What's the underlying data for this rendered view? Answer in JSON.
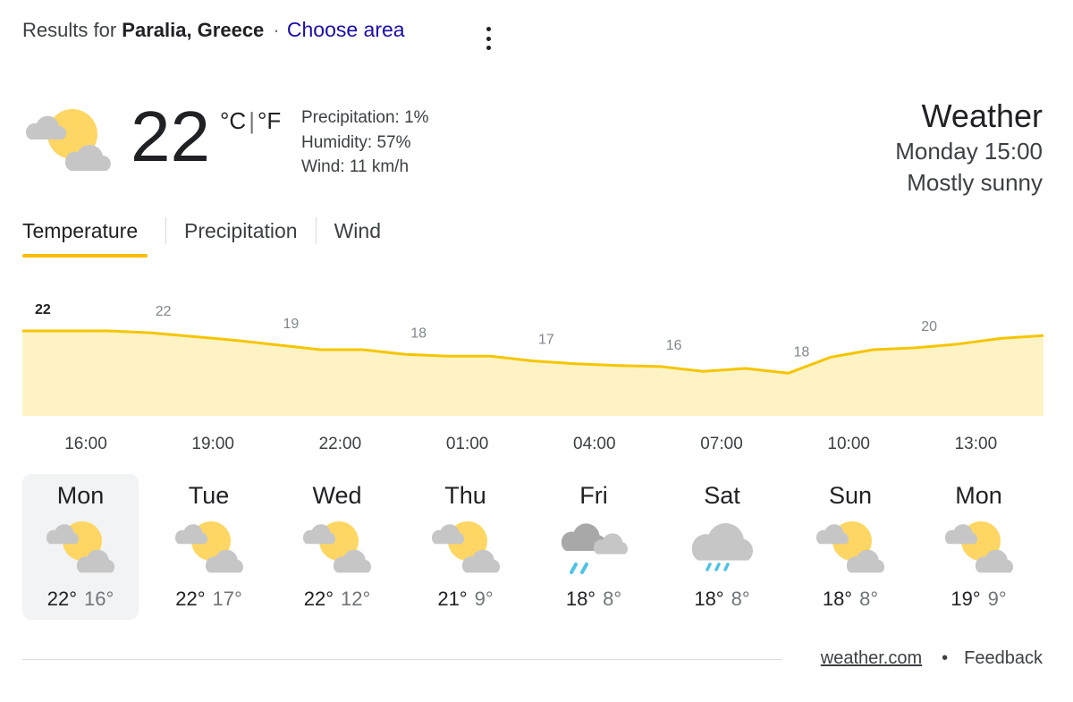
{
  "header": {
    "results_prefix": "Results for",
    "location": "Paralia, Greece",
    "separator": "·",
    "choose_area": "Choose area"
  },
  "current": {
    "icon": "partly-sunny-icon",
    "temperature": "22",
    "unit_c": "°C",
    "unit_sep": "|",
    "unit_f": "°F",
    "precipitation": "Precipitation: 1%",
    "humidity": "Humidity: 57%",
    "wind": "Wind: 11 km/h"
  },
  "summary": {
    "title": "Weather",
    "when": "Monday 15:00",
    "condition": "Mostly sunny"
  },
  "tabs": [
    {
      "label": "Temperature",
      "active": true
    },
    {
      "label": "Precipitation",
      "active": false
    },
    {
      "label": "Wind",
      "active": false
    }
  ],
  "chart_data": {
    "type": "area",
    "x": [
      "15:00",
      "16:00",
      "17:00",
      "18:00",
      "19:00",
      "20:00",
      "21:00",
      "22:00",
      "23:00",
      "00:00",
      "01:00",
      "02:00",
      "03:00",
      "04:00",
      "05:00",
      "06:00",
      "07:00",
      "08:00",
      "09:00",
      "10:00",
      "11:00",
      "12:00",
      "13:00",
      "14:00"
    ],
    "values": [
      22,
      22,
      22,
      21.8,
      21.4,
      21,
      20.5,
      20,
      20,
      19.5,
      19.3,
      19.3,
      18.8,
      18.5,
      18.3,
      18.2,
      17.7,
      18,
      17.5,
      19.2,
      20,
      20.2,
      20.6,
      21.2,
      21.5
    ],
    "labels": [
      {
        "index": 0,
        "value": "22",
        "emphasized": true
      },
      {
        "index": 3,
        "value": "22",
        "emphasized": false
      },
      {
        "index": 6,
        "value": "19",
        "emphasized": false
      },
      {
        "index": 9,
        "value": "18",
        "emphasized": false
      },
      {
        "index": 12,
        "value": "17",
        "emphasized": false
      },
      {
        "index": 15,
        "value": "16",
        "emphasized": false
      },
      {
        "index": 18,
        "value": "18",
        "emphasized": false
      },
      {
        "index": 21,
        "value": "20",
        "emphasized": false
      }
    ],
    "hour_labels": [
      "16:00",
      "19:00",
      "22:00",
      "01:00",
      "04:00",
      "07:00",
      "10:00",
      "13:00"
    ],
    "line_color": "#f6c500",
    "fill_color": "#fdf3c4",
    "label_color": "#80868b",
    "emphasized_label_color": "#202124"
  },
  "days": [
    {
      "name": "Mon",
      "icon": "partly-sunny-icon",
      "high": "22°",
      "low": "16°",
      "selected": true
    },
    {
      "name": "Tue",
      "icon": "partly-sunny-icon",
      "high": "22°",
      "low": "17°",
      "selected": false
    },
    {
      "name": "Wed",
      "icon": "partly-sunny-icon",
      "high": "22°",
      "low": "12°",
      "selected": false
    },
    {
      "name": "Thu",
      "icon": "partly-sunny-icon",
      "high": "21°",
      "low": "9°",
      "selected": false
    },
    {
      "name": "Fri",
      "icon": "rain-showers-icon",
      "high": "18°",
      "low": "8°",
      "selected": false
    },
    {
      "name": "Sat",
      "icon": "rain-icon",
      "high": "18°",
      "low": "8°",
      "selected": false
    },
    {
      "name": "Sun",
      "icon": "partly-sunny-icon",
      "high": "18°",
      "low": "8°",
      "selected": false
    },
    {
      "name": "Mon",
      "icon": "partly-sunny-icon",
      "high": "19°",
      "low": "9°",
      "selected": false
    }
  ],
  "footer": {
    "source": "weather.com",
    "dot": "•",
    "feedback": "Feedback"
  },
  "colors": {
    "sun": "#fdd663",
    "cloud": "#c6c6c6",
    "cloud_dark": "#a8a8a8",
    "rain": "#4ec3e6",
    "link": "#1a0dab",
    "accent": "#fbbc04"
  }
}
